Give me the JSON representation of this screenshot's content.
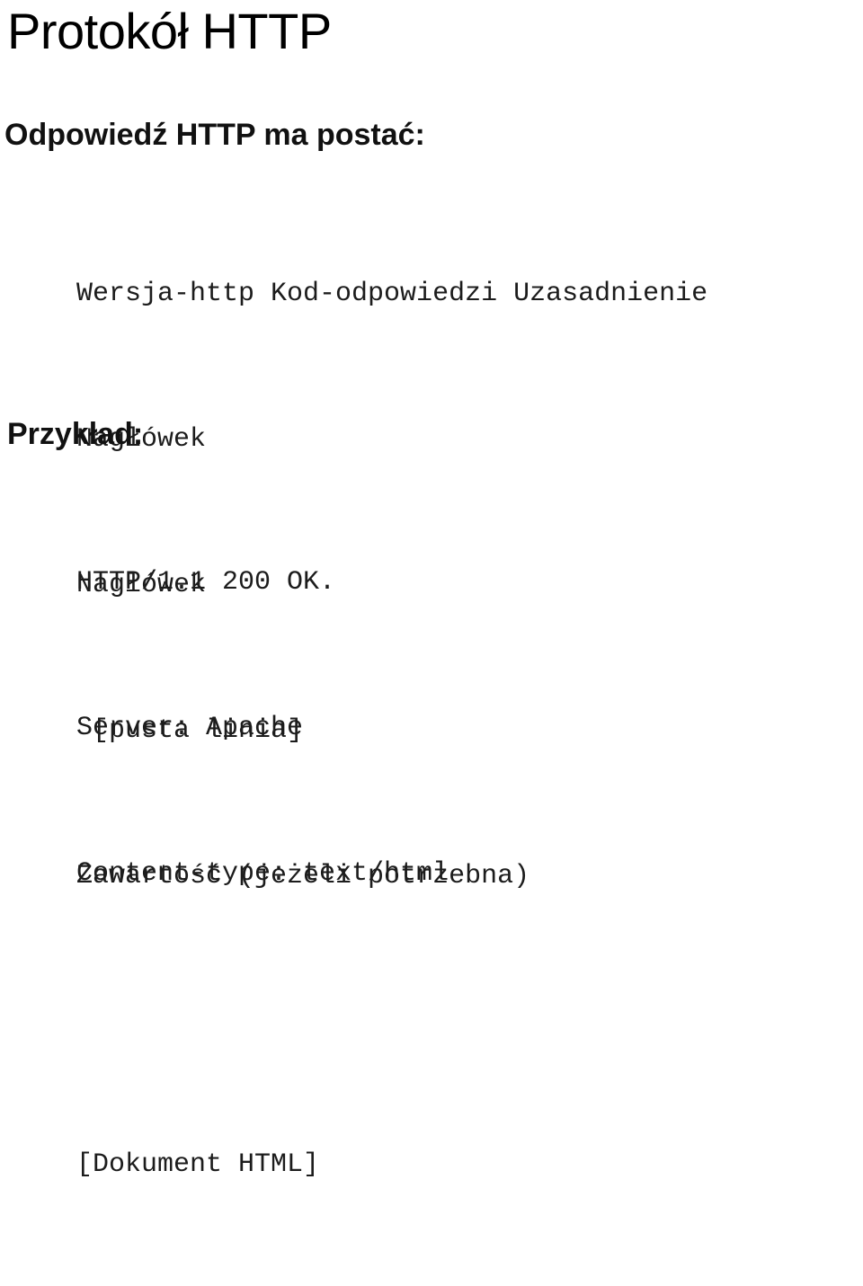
{
  "slide": {
    "title": "Protokół HTTP",
    "background_color": "#ffffff",
    "text_color": "#000000"
  },
  "sections": {
    "response": {
      "heading": "Odpowiedź HTTP ma postać:",
      "lines": [
        "Wersja-http Kod-odpowiedzi Uzasadnienie",
        "Nagłówek",
        "Nagłówek",
        " [pusta linia]",
        "Zawartość (jeżeli potrzebna)"
      ]
    },
    "example": {
      "heading": "Przykład:",
      "lines": [
        "HTTP/1.1 200 OK.",
        "Server: Apache",
        "Content-type: text/html",
        "",
        "[Dokument HTML]"
      ]
    }
  }
}
